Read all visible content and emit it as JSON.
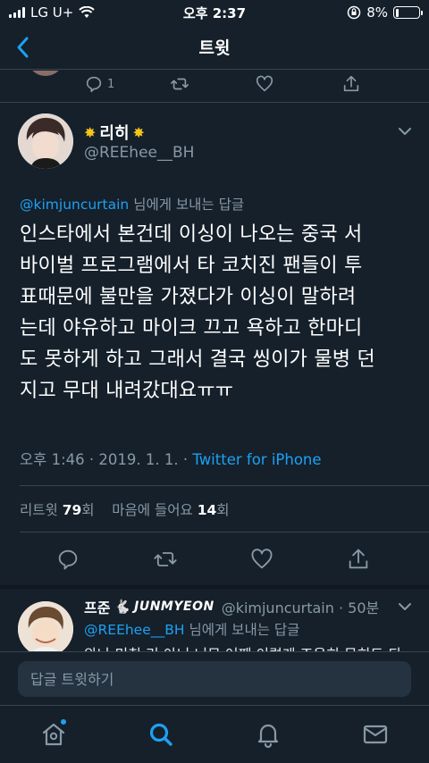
{
  "status_bar": {
    "carrier": "LG U+",
    "time": "오후 2:37",
    "battery": "8%",
    "battery_level": 0.08
  },
  "nav": {
    "title": "트윗"
  },
  "prev_tweet": {
    "reply_count": "1"
  },
  "tweet": {
    "display_name": "리히",
    "handle": "@REEhee__BH",
    "reply_to_mention": "@kimjuncurtain",
    "reply_to_suffix": " 님에게 보내는 답글",
    "lines": [
      "인스타에서 본건데 이싱이 나오는 중국 서",
      "바이벌 프로그램에서 타 코치진 팬들이 투",
      "표때문에 불만을 가졌다가 이싱이 말하려",
      "는데 야유하고 마이크 끄고 욕하고 한마디",
      "도 못하게 하고 그래서 결국 씽이가 물병 던",
      "지고 무대 내려갔대요ㅠㅠ"
    ],
    "timestamp": "오후 1:46 · 2019. 1. 1. · ",
    "source": "Twitter for iPhone",
    "retweet_label": "리트윗 ",
    "retweet_count": "79",
    "retweet_suffix": "회",
    "like_label": "마음에 들어요 ",
    "like_count": "14",
    "like_suffix": "회"
  },
  "reply": {
    "name_prefix": "프준",
    "name_suffix": "JUNMYEON",
    "handle": "@kimjuncurtain · 50분",
    "reply_to_mention": "@REEhee__BH",
    "reply_to_suffix": " 님에게 보내는 답글",
    "text": "와나 미친 리 아니 너무 어째 이렇게 조용히 묻히도 되"
  },
  "compose": {
    "placeholder": "답글 트윗하기"
  },
  "colors": {
    "background": "#15202b",
    "accent": "#1da1f2",
    "secondary_text": "#8899a6",
    "divider": "#38444d"
  }
}
